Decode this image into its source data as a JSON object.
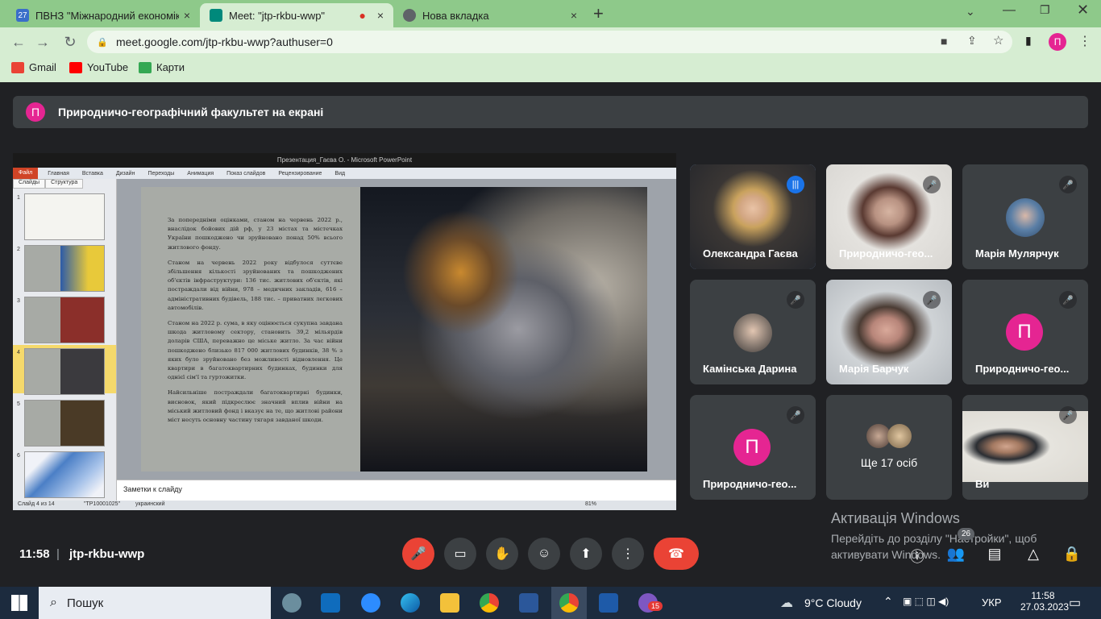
{
  "browser": {
    "tabs": [
      {
        "title": "ПВНЗ \"Міжнародний економіко-",
        "fav": "27",
        "fav_color": "#3a6ec9"
      },
      {
        "title": "Meet: \"jtp-rkbu-wwp\"",
        "fav": "",
        "fav_color": "#00897b",
        "recording": "●"
      },
      {
        "title": "Нова вкладка",
        "fav": "",
        "fav_color": "#5f6368"
      }
    ],
    "close_glyph": "×",
    "new_tab": "+",
    "url": "meet.google.com/jtp-rkbu-wwp?authuser=0",
    "profile_initial": "П",
    "bookmarks": [
      {
        "label": "Gmail",
        "color": "#ea4335"
      },
      {
        "label": "YouTube",
        "color": "#ff0000"
      },
      {
        "label": "Карти",
        "color": "#34a853"
      }
    ]
  },
  "meet": {
    "presenter_initial": "П",
    "presenter_banner": "Природничо-географічний факультет на екрані",
    "time": "11:58",
    "separator": "|",
    "meeting_code": "jtp-rkbu-wwp",
    "people_count": "26"
  },
  "presentation": {
    "window_title": "Презентация_Гаєва О. - Microsoft PowerPoint",
    "ribbon": [
      "Файл",
      "Главная",
      "Вставка",
      "Дизайн",
      "Переходы",
      "Анимация",
      "Показ слайдов",
      "Рецензирование",
      "Вид"
    ],
    "panel_tabs": [
      "Слайды",
      "Структура"
    ],
    "thumbnails": [
      "1",
      "2",
      "3",
      "4",
      "5",
      "6"
    ],
    "slide_paragraphs": [
      "За попередніми оцінками, станом на червень 2022 р., внаслідок бойових дій рф, у 23 містах та містечках України пошкоджено чи зруйновано понад 50% всього житлового фонду.",
      "Станом на червень 2022 року відбулося суттєве збільшення кількості зруйнованих та пошкоджених об'єктів інфраструктури: 136 тис. житлових об'єктів, які постраждали від війни, 978 – медичних закладів, 616 – адміністративних будівель, 188 тис. – приватних легкових автомобілів.",
      "Станом на 2022 р. сума, в яку оцінюється сукупна завдана шкода житловому сектору, становить 39,2 мільярдів доларів США, переважно це міське житло. За час війни пошкоджено близько 817 000 житлових будинків, 38 % з яких було зруйновано без можливості відновлення. Це квартири в багатоквартирних будинках, будинки для однієї сім'ї та гуртожитки.",
      "Найсильніше постраждали багатоквартирні будинки, висновок, який підкреслює значний вплив війни на міський житловий фонд і вказує на те, що житлові райони міст несуть основну частину тягаря завданої шкоди."
    ],
    "notes_placeholder": "Заметки к слайду",
    "status_slide": "Слайд 4 из 14",
    "status_theme": "\"ТР10001025\"",
    "status_lang": "украинский",
    "zoom": "81%"
  },
  "participants": [
    {
      "name": "Олександра Гаєва",
      "muted": false,
      "speaking": true,
      "kind": "video"
    },
    {
      "name": "Природничо-гео...",
      "muted": true,
      "speaking": false,
      "kind": "video"
    },
    {
      "name": "Марія Мулярчук",
      "muted": true,
      "speaking": false,
      "kind": "photo"
    },
    {
      "name": "Камінська Дарина",
      "muted": true,
      "speaking": false,
      "kind": "photo"
    },
    {
      "name": "Марія Барчук",
      "muted": true,
      "speaking": false,
      "kind": "video"
    },
    {
      "name": "Природничо-гео...",
      "muted": true,
      "speaking": false,
      "kind": "initial",
      "initial": "П"
    },
    {
      "name": "Природничо-гео...",
      "muted": true,
      "speaking": false,
      "kind": "initial",
      "initial": "П"
    },
    {
      "name": "Ще 17 осіб",
      "muted": false,
      "speaking": false,
      "kind": "more"
    },
    {
      "name": "Ви",
      "muted": true,
      "speaking": false,
      "kind": "video"
    }
  ],
  "icons": {
    "mic_off": "🎤",
    "mic_on": "|||",
    "camera": "▭",
    "hand": "✋",
    "emoji": "☺",
    "present": "⬆",
    "more": "⋮",
    "leave": "☎",
    "info": "ⓘ",
    "people": "👥",
    "chat": "▤",
    "activities": "△",
    "host": "🔒"
  },
  "activation": {
    "title": "Активація Windows",
    "body": "Перейдіть до розділу \"Настройки\", щоб активувати Windows."
  },
  "taskbar": {
    "search": "Пошук",
    "weather": "9°C  Cloudy",
    "lang": "УКР",
    "time": "11:58",
    "date": "27.03.2023",
    "notif_badge": "15"
  }
}
